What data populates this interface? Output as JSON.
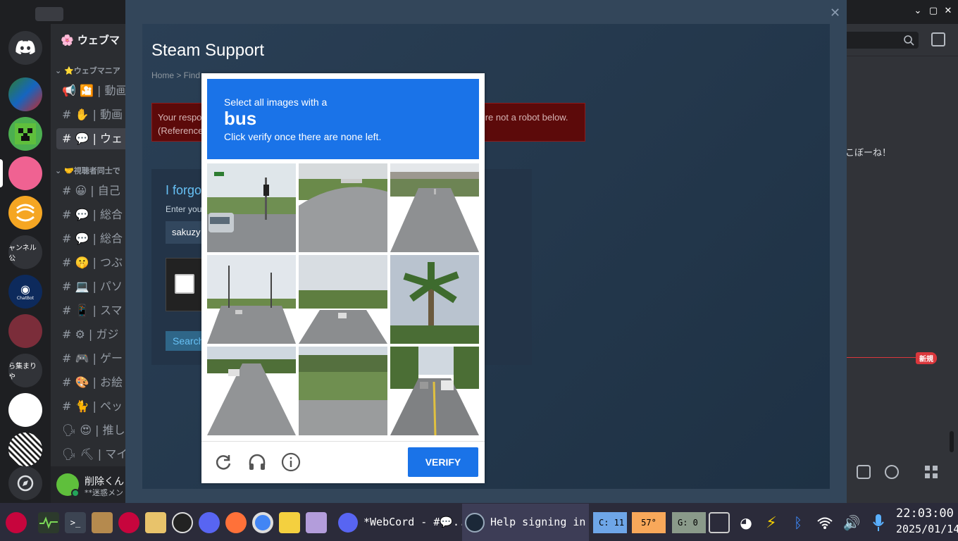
{
  "discord": {
    "server_title": "ウェブマ",
    "category1": "⭐ウェブマニア",
    "category2": "🤝視聴者同士で",
    "channels": [
      {
        "prefix": "📢",
        "label": "🎦 | 動画"
      },
      {
        "prefix": "#",
        "label": "✋ | 動画"
      },
      {
        "prefix": "#",
        "label": "💬 | ウェ"
      },
      {
        "prefix": "#",
        "label": "😀 | 自己"
      },
      {
        "prefix": "#",
        "label": "💬 | 総合"
      },
      {
        "prefix": "#",
        "label": "💬 | 総合"
      },
      {
        "prefix": "#",
        "label": "🤫 | つぶ"
      },
      {
        "prefix": "#",
        "label": "💻 | パソ"
      },
      {
        "prefix": "#",
        "label": "📱 | スマ"
      },
      {
        "prefix": "#",
        "label": "⚙ | ガジ"
      },
      {
        "prefix": "#",
        "label": "🎮 | ゲー"
      },
      {
        "prefix": "#",
        "label": "🎨 | お絵"
      },
      {
        "prefix": "#",
        "label": "🐈 | ペッ"
      },
      {
        "prefix": "🗣",
        "label": "😍 | 推し"
      },
      {
        "prefix": "🗣",
        "label": "⛏ | マイ"
      }
    ],
    "guild_labels": {
      "channel_pub": "ャンネル公",
      "chatbot": "ChatBot",
      "collect": "ら集まりや"
    },
    "user_name": "削除くん",
    "user_status": "**迷惑メン",
    "right_message": "こぼーね！",
    "new_badge": "新規"
  },
  "steam": {
    "title": "Steam Support",
    "breadcrumb": "Home > Find",
    "error_line1": "Your respo",
    "error_line2": "(Reference",
    "error_tail": "u're not a robot below.",
    "forgot_title": "I forgo",
    "enter_your": "Enter you",
    "account_value": "sakuzy",
    "search_label": "Search"
  },
  "captcha": {
    "instruction": "Select all images with a",
    "target": "bus",
    "sub": "Click verify once there are none left.",
    "verify_label": "VERIFY",
    "tiles": [
      {
        "id": 1,
        "scene": "intersection-traffic-light-car"
      },
      {
        "id": 2,
        "scene": "road-curve-grass"
      },
      {
        "id": 3,
        "scene": "highway-overpass"
      },
      {
        "id": 4,
        "scene": "intersection-poles"
      },
      {
        "id": 5,
        "scene": "highway-cars-trees"
      },
      {
        "id": 6,
        "scene": "palm-tree"
      },
      {
        "id": 7,
        "scene": "highway-cars"
      },
      {
        "id": 8,
        "scene": "road-grass-median"
      },
      {
        "id": 9,
        "scene": "street-with-cars"
      }
    ],
    "accent": "#1a73e8"
  },
  "taskbar": {
    "task1": "*WebCord - #💬..",
    "task2": "Help signing in",
    "cpu": "C: 11",
    "temp": "57°",
    "gpu": "G: 0",
    "time": "22:03:00",
    "date": "2025/01/14"
  }
}
